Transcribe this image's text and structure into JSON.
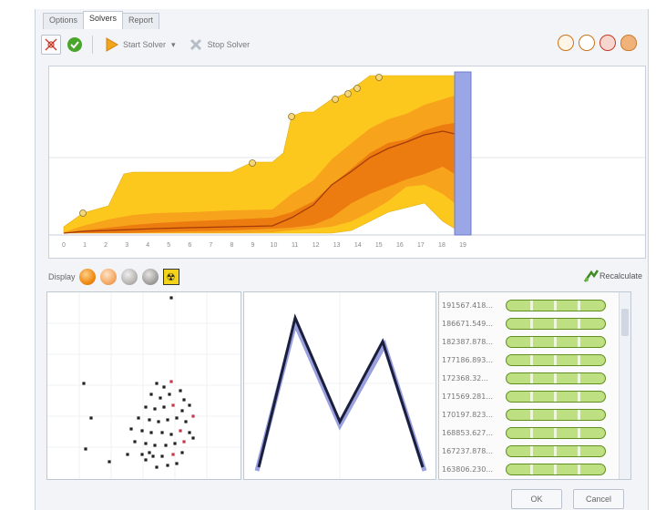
{
  "tabs": [
    "Options",
    "Solvers",
    "Report"
  ],
  "toolbar": {
    "start_label": "Start Solver",
    "start_dropdown": "▾",
    "stop_label": "Stop Solver",
    "icons": [
      "scatter-icon",
      "check-icon",
      "play-icon",
      "stop-x-icon"
    ],
    "right_icons": [
      "zoom-icon",
      "clock-icon",
      "stop-icon",
      "egg-icon"
    ]
  },
  "chart": {
    "x_ticks": [
      "0",
      "1",
      "2",
      "3",
      "4",
      "5",
      "6",
      "7",
      "8",
      "9",
      "10",
      "11",
      "12",
      "13",
      "14",
      "15",
      "16",
      "17",
      "18",
      "19"
    ],
    "marker_x": 18.5,
    "colors": {
      "outer": "#fdc81e",
      "mid": "#f7a31b",
      "inner": "#ed7c10",
      "line": "#a33b09",
      "marker": "#9aa6e6"
    }
  },
  "display": {
    "label": "Display",
    "recalculate": "Recalculate",
    "balls": [
      "#f18a11",
      "#f5a863",
      "#b9b6b4",
      "#a3a19f"
    ]
  },
  "list": {
    "values": [
      "191567.418...",
      "186671.549...",
      "182387.878...",
      "177186.893...",
      "172368.32...",
      "171569.281...",
      "170197.823...",
      "168853.627...",
      "167237.878...",
      "163806.230..."
    ]
  },
  "footer": {
    "ok": "OK",
    "cancel": "Cancel"
  }
}
